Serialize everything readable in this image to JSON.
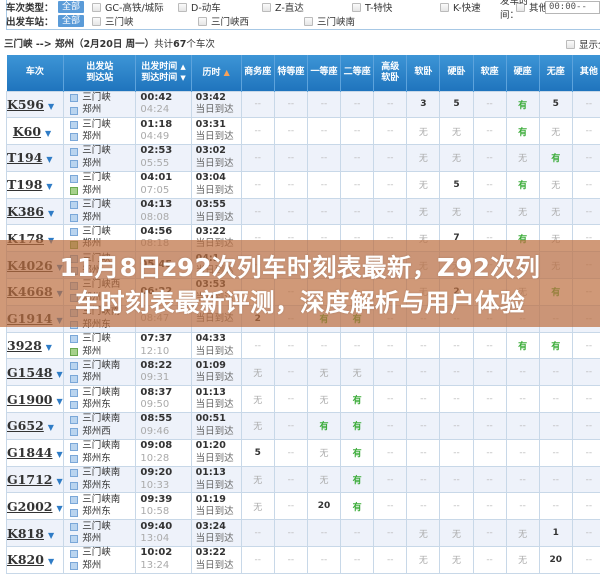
{
  "filters": {
    "train_type_label": "车次类型：",
    "station_label": "出发车站：",
    "all_label": "全部",
    "train_types": [
      "GC-高铁/城际",
      "D-动车",
      "Z-直达",
      "T-特快",
      "K-快速",
      "其他"
    ],
    "stations": [
      "三门峡",
      "三门峡西",
      "三门峡南"
    ],
    "dep_time_label": "发车时间：",
    "dep_time_value": "00:00--"
  },
  "route": {
    "from": "三门峡",
    "arrow": " --> ",
    "to": "郑州",
    "date": "（2月20日  周一）",
    "total_prefix": "共计",
    "total": "67",
    "total_suffix": "个车次"
  },
  "show_all_label": "显示全",
  "table": {
    "headers": {
      "train": "车次",
      "station_from": "出发站",
      "station_to": "到达站",
      "time_dep": "出发时间",
      "time_arr": "到达时间",
      "duration": "历时",
      "seats": [
        "商务座",
        "特等座",
        "一等座",
        "二等座",
        "高级软卧",
        "软卧",
        "硬卧",
        "软座",
        "硬座",
        "无座",
        "其他"
      ]
    },
    "same_day": "当日到达",
    "rows": [
      {
        "no": "K596",
        "from": "三门峡",
        "to": "郑州",
        "dep": "00:42",
        "arr": "04:24",
        "dur": "03:42",
        "seats": [
          "--",
          "--",
          "--",
          "--",
          "--",
          "3",
          "5",
          "--",
          "有",
          "5",
          "--"
        ]
      },
      {
        "no": "K60",
        "from": "三门峡",
        "to": "郑州",
        "dep": "01:18",
        "arr": "04:49",
        "dur": "03:31",
        "seats": [
          "--",
          "--",
          "--",
          "--",
          "--",
          "无",
          "无",
          "--",
          "有",
          "无",
          "--"
        ]
      },
      {
        "no": "T194",
        "from": "三门峡",
        "to": "郑州",
        "dep": "02:53",
        "arr": "05:55",
        "dur": "03:02",
        "seats": [
          "--",
          "--",
          "--",
          "--",
          "--",
          "无",
          "无",
          "--",
          "无",
          "有",
          "--"
        ]
      },
      {
        "no": "T198",
        "from": "三门峡",
        "to": "郑州",
        "dep": "04:01",
        "arr": "07:05",
        "dur": "03:04",
        "seats": [
          "--",
          "--",
          "--",
          "--",
          "--",
          "无",
          "5",
          "--",
          "有",
          "无",
          "--"
        ]
      },
      {
        "no": "K386",
        "from": "三门峡",
        "to": "郑州",
        "dep": "04:13",
        "arr": "08:08",
        "dur": "03:55",
        "seats": [
          "--",
          "--",
          "--",
          "--",
          "--",
          "无",
          "无",
          "--",
          "无",
          "无",
          "--"
        ]
      },
      {
        "no": "K178",
        "from": "三门峡",
        "to": "郑州",
        "dep": "04:56",
        "arr": "08:18",
        "dur": "03:22",
        "seats": [
          "--",
          "--",
          "--",
          "--",
          "--",
          "无",
          "7",
          "--",
          "有",
          "无",
          "--"
        ]
      },
      {
        "no": "K4026",
        "from": "三门峡",
        "to": "郑州",
        "dep": "05:45",
        "arr": "",
        "dur": "04:1",
        "seats": [
          "--",
          "--",
          "--",
          "--",
          "--",
          "无",
          "无",
          "--",
          "无",
          "无",
          "--"
        ]
      },
      {
        "no": "K4668",
        "from": "三门峡西",
        "to": "郑州",
        "dep": "06:22",
        "arr": "",
        "dur": "03:53",
        "seats": [
          "--",
          "--",
          "--",
          "--",
          "--",
          "无",
          "2",
          "--",
          "无",
          "有",
          "--"
        ]
      },
      {
        "no": "G1914",
        "from": "三门峡南",
        "to": "郑州东",
        "dep": "",
        "arr": "08:47",
        "dur": "",
        "seats": [
          "2",
          "--",
          "有",
          "有",
          "--",
          "--",
          "--",
          "--",
          "--",
          "--",
          "--"
        ]
      },
      {
        "no": "3928",
        "from": "三门峡",
        "to": "郑州",
        "dep": "07:37",
        "arr": "12:10",
        "dur": "04:33",
        "seats": [
          "--",
          "--",
          "--",
          "--",
          "--",
          "--",
          "--",
          "--",
          "有",
          "有",
          "--"
        ]
      },
      {
        "no": "G1548",
        "from": "三门峡南",
        "to": "郑州",
        "dep": "08:22",
        "arr": "09:31",
        "dur": "01:09",
        "seats": [
          "无",
          "--",
          "无",
          "无",
          "--",
          "--",
          "--",
          "--",
          "--",
          "--",
          "--"
        ]
      },
      {
        "no": "G1900",
        "from": "三门峡南",
        "to": "郑州东",
        "dep": "08:37",
        "arr": "09:50",
        "dur": "01:13",
        "seats": [
          "无",
          "--",
          "无",
          "有",
          "--",
          "--",
          "--",
          "--",
          "--",
          "--",
          "--"
        ]
      },
      {
        "no": "G652",
        "from": "三门峡南",
        "to": "郑州西",
        "dep": "08:55",
        "arr": "09:46",
        "dur": "00:51",
        "seats": [
          "无",
          "--",
          "有",
          "有",
          "--",
          "--",
          "--",
          "--",
          "--",
          "--",
          "--"
        ]
      },
      {
        "no": "G1844",
        "from": "三门峡南",
        "to": "郑州东",
        "dep": "09:08",
        "arr": "10:28",
        "dur": "01:20",
        "seats": [
          "5",
          "--",
          "无",
          "有",
          "--",
          "--",
          "--",
          "--",
          "--",
          "--",
          "--"
        ]
      },
      {
        "no": "G1712",
        "from": "三门峡南",
        "to": "郑州东",
        "dep": "09:20",
        "arr": "10:33",
        "dur": "01:13",
        "seats": [
          "无",
          "--",
          "无",
          "有",
          "--",
          "--",
          "--",
          "--",
          "--",
          "--",
          "--"
        ]
      },
      {
        "no": "G2002",
        "from": "三门峡南",
        "to": "郑州东",
        "dep": "09:39",
        "arr": "10:58",
        "dur": "01:19",
        "seats": [
          "无",
          "--",
          "20",
          "有",
          "--",
          "--",
          "--",
          "--",
          "--",
          "--",
          "--"
        ]
      },
      {
        "no": "K818",
        "from": "三门峡",
        "to": "郑州",
        "dep": "09:40",
        "arr": "13:04",
        "dur": "03:24",
        "seats": [
          "--",
          "--",
          "--",
          "--",
          "--",
          "无",
          "无",
          "--",
          "无",
          "1",
          "--"
        ]
      },
      {
        "no": "K820",
        "from": "三门峡",
        "to": "郑州",
        "dep": "10:02",
        "arr": "13:24",
        "dur": "03:22",
        "seats": [
          "--",
          "--",
          "--",
          "--",
          "--",
          "无",
          "无",
          "--",
          "无",
          "20",
          "--"
        ]
      }
    ]
  },
  "overlay": {
    "line1": "11月8日z92次列车时刻表最新，Z92次列",
    "line2": "车时刻表最新评测，深度解析与用户体验"
  },
  "colors": {
    "header_blue": "#1f74bd",
    "available_green": "#3cac3a",
    "overlay_brown": "#bc6e3e"
  }
}
